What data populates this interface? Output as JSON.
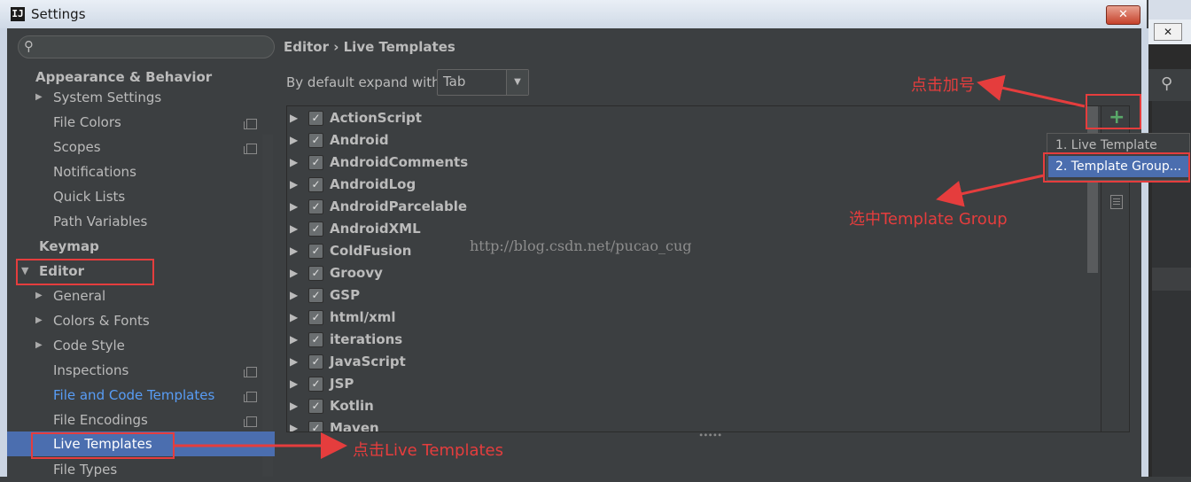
{
  "window": {
    "title": "Settings",
    "close_label": "✕"
  },
  "search": {
    "icon": "search-icon"
  },
  "sidebar": {
    "section_appearance": "Appearance & Behavior",
    "appearance_items": [
      {
        "label": "System Settings",
        "expandable": true
      },
      {
        "label": "File Colors",
        "copy_icon": true
      },
      {
        "label": "Scopes",
        "copy_icon": true
      },
      {
        "label": "Notifications"
      },
      {
        "label": "Quick Lists"
      },
      {
        "label": "Path Variables"
      }
    ],
    "keymap": "Keymap",
    "editor": "Editor",
    "editor_items": [
      {
        "label": "General",
        "expandable": true
      },
      {
        "label": "Colors & Fonts",
        "expandable": true
      },
      {
        "label": "Code Style",
        "expandable": true
      },
      {
        "label": "Inspections",
        "copy_icon": true
      },
      {
        "label": "File and Code Templates",
        "copy_icon": true,
        "highlight": "#589df6"
      },
      {
        "label": "File Encodings",
        "copy_icon": true
      },
      {
        "label": "Live Templates",
        "selected": true
      },
      {
        "label": "File Types"
      }
    ]
  },
  "main": {
    "breadcrumb": "Editor › Live Templates",
    "expand_label": "By default expand with",
    "expand_value": "Tab",
    "template_groups": [
      "ActionScript",
      "Android",
      "AndroidComments",
      "AndroidLog",
      "AndroidParcelable",
      "AndroidXML",
      "ColdFusion",
      "Groovy",
      "GSP",
      "html/xml",
      "iterations",
      "JavaScript",
      "JSP",
      "Kotlin",
      "Maven"
    ],
    "watermark": "http://blog.csdn.net/pucao_cug"
  },
  "popup": {
    "items": [
      "1. Live Template",
      "2. Template Group..."
    ],
    "selected_index": 1
  },
  "annotations": {
    "click_plus": "点击加号",
    "select_group": "选中Template Group",
    "click_live": "点击Live Templates",
    "color": "#e53d3d"
  },
  "colors": {
    "background": "#3c3f41",
    "selection": "#4b6eaf",
    "text": "#bbbbbb",
    "link": "#589df6",
    "add_green": "#59a869"
  }
}
